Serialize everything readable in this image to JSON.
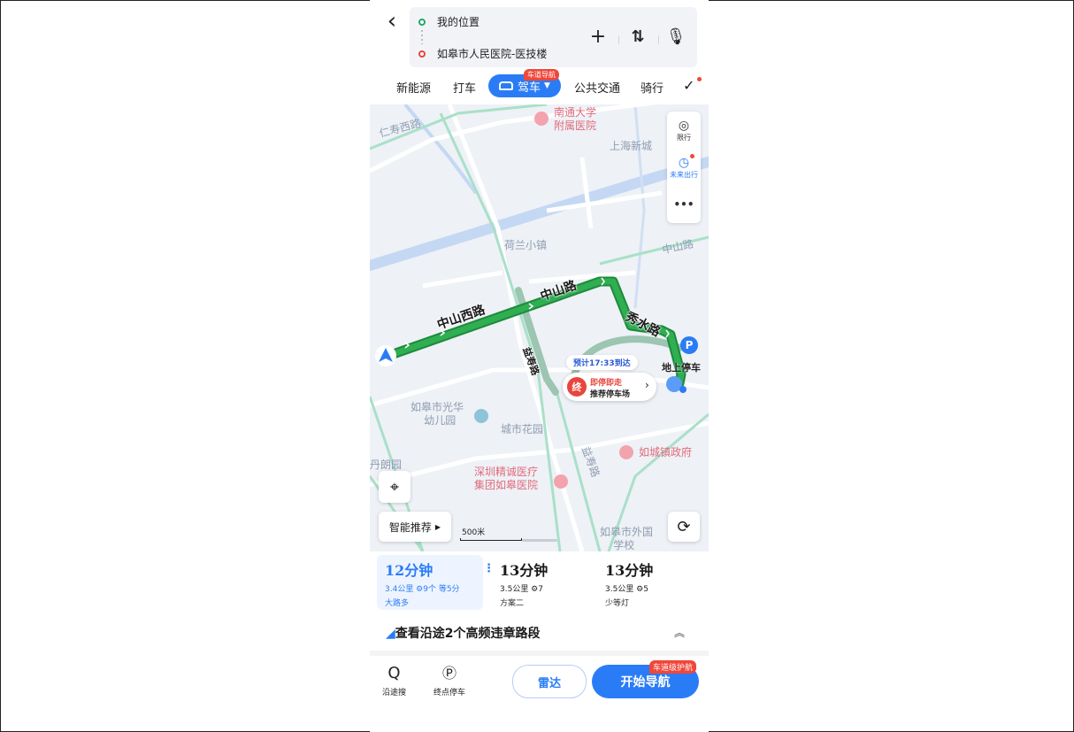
{
  "header": {
    "origin": "我的位置",
    "destination": "如皋市人民医院-医技楼"
  },
  "modes": {
    "items": [
      "新能源",
      "打车",
      "公共交通",
      "骑行"
    ],
    "active": "驾车",
    "active_badge": "车道导航"
  },
  "map": {
    "labels": [
      "南通大学",
      "附属医院",
      "上海新城",
      "荷兰小镇",
      "如皋市光华",
      "幼儿园",
      "城市花园",
      "如城镇政府",
      "深圳精诚医疗",
      "集团如皋医院",
      "如皋市外国",
      "学校",
      "仁寿西路",
      "中山路",
      "益寿路",
      "丹朗园"
    ],
    "roads": [
      "中山西路",
      "中山路",
      "秀水路",
      "益寿路"
    ],
    "tools": [
      {
        "icon": "restriction-icon",
        "label": "限行"
      },
      {
        "icon": "future-trip-icon",
        "label": "未来出行"
      }
    ],
    "more": "•••",
    "smart_recommend": "智能推荐",
    "scale": "500米",
    "eta": "预计17:33到达",
    "parking_title": "即停即走",
    "parking_sub": "推荐停车场",
    "end_badge": "终",
    "parking_poi": "地上停车",
    "parking_badge": "P",
    "colors": {
      "route": "#2fae52",
      "route_border": "#1e8a3c",
      "alt_route": "#9cc5b2",
      "accent": "#2a7cf6"
    }
  },
  "routes": [
    {
      "time": "12分钟",
      "meta": "3.4公里 ⚙9个 等5分",
      "tag": "大路多"
    },
    {
      "time": "13分钟",
      "meta": "3.5公里 ⚙7",
      "tag": "方案二"
    },
    {
      "time": "13分钟",
      "meta": "3.5公里 ⚙5",
      "tag": "少等灯"
    }
  ],
  "violation": "查看沿途2个高频违章路段",
  "bottom": {
    "search_along": "沿途搜",
    "end_parking": "终点停车",
    "radar": "雷达",
    "start_nav": "开始导航",
    "start_badge": "车道级护航"
  }
}
